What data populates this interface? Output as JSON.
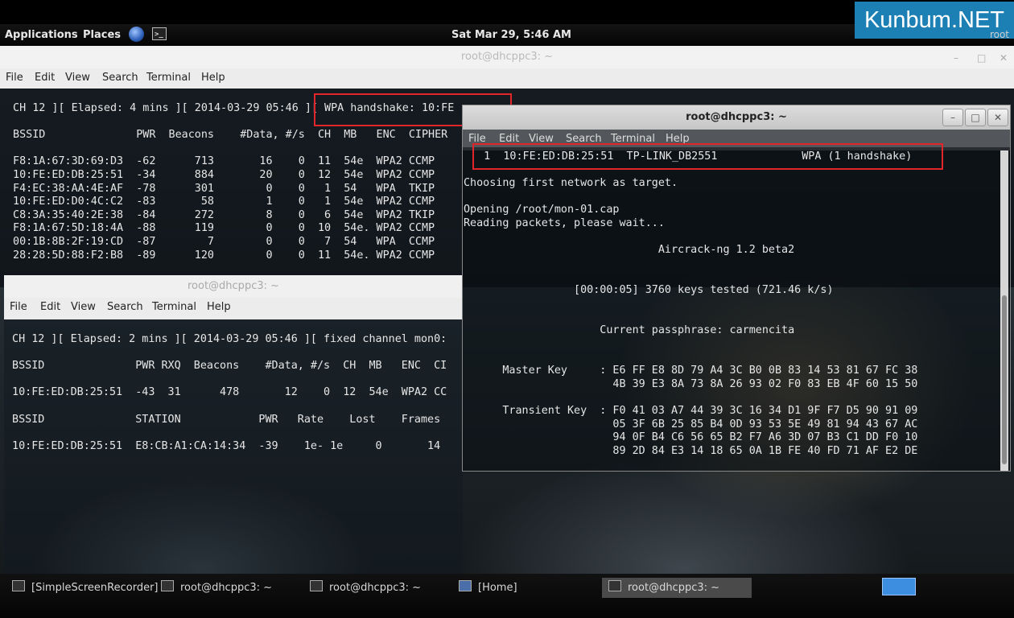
{
  "top_panel": {
    "applications": "Applications",
    "places": "Places",
    "clock": "Sat Mar 29,  5:46 AM",
    "user": "root",
    "watermark": "Kunbum.NET"
  },
  "window1": {
    "title": "root@dhcppc3: ~",
    "menu": [
      "File",
      "Edit",
      "View",
      "Search",
      "Terminal",
      "Help"
    ],
    "lines": [
      " CH 12 ][ Elapsed: 4 mins ][ 2014-03-29 05:46 ][ WPA handshake: 10:FE",
      "",
      " BSSID              PWR  Beacons    #Data, #/s  CH  MB   ENC  CIPHER",
      "",
      " F8:1A:67:3D:69:D3  -62      713       16    0  11  54e  WPA2 CCMP",
      " 10:FE:ED:DB:25:51  -34      884       20    0  12  54e  WPA2 CCMP",
      " F4:EC:38:AA:4E:AF  -78      301        0    0   1  54   WPA  TKIP",
      " 10:FE:ED:D0:4C:C2  -83       58        1    0   1  54e  WPA2 CCMP",
      " C8:3A:35:40:2E:38  -84      272        8    0   6  54e  WPA2 TKIP",
      " F8:1A:67:5D:18:4A  -88      119        0    0  10  54e. WPA2 CCMP",
      " 00:1B:8B:2F:19:CD  -87        7        0    0   7  54   WPA  CCMP",
      " 28:28:5D:88:F2:B8  -89      120        0    0  11  54e. WPA2 CCMP"
    ]
  },
  "window2": {
    "title": "root@dhcppc3: ~",
    "menu": [
      "File",
      "Edit",
      "View",
      "Search",
      "Terminal",
      "Help"
    ],
    "lines": [
      "",
      " CH 12 ][ Elapsed: 2 mins ][ 2014-03-29 05:46 ][ fixed channel mon0:",
      "",
      " BSSID              PWR RXQ  Beacons    #Data, #/s  CH  MB   ENC  CI",
      "",
      " 10:FE:ED:DB:25:51  -43  31      478       12    0  12  54e  WPA2 CC",
      "",
      " BSSID              STATION            PWR   Rate    Lost    Frames",
      "",
      " 10:FE:ED:DB:25:51  E8:CB:A1:CA:14:34  -39    1e- 1e     0       14"
    ]
  },
  "window3": {
    "title": "root@dhcppc3: ~",
    "menu": [
      "File",
      "Edit",
      "View",
      "Search",
      "Terminal",
      "Help"
    ],
    "lines": [
      "   1  10:FE:ED:DB:25:51  TP-LINK_DB2551             WPA (1 handshake)",
      "",
      "Choosing first network as target.",
      "",
      "Opening /root/mon-01.cap",
      "Reading packets, please wait...",
      "",
      "                              Aircrack-ng 1.2 beta2",
      "",
      "",
      "                 [00:00:05] 3760 keys tested (721.46 k/s)",
      "",
      "",
      "                     Current passphrase: carmencita",
      "",
      "",
      "      Master Key     : E6 FF E8 8D 79 A4 3C B0 0B 83 14 53 81 67 FC 38",
      "                       4B 39 E3 8A 73 8A 26 93 02 F0 83 EB 4F 60 15 50",
      "",
      "      Transient Key  : F0 41 03 A7 44 39 3C 16 34 D1 9F F7 D5 90 91 09",
      "                       05 3F 6B 25 85 B4 0D 93 53 5E 49 81 94 43 67 AC",
      "                       94 0F B4 C6 56 65 B2 F7 A6 3D 07 B3 C1 DD F0 10",
      "                       89 2D 84 E3 14 18 65 0A 1B FE 40 FD 71 AF E2 DE"
    ]
  },
  "taskbar": {
    "items": [
      "[SimpleScreenRecorder]",
      "root@dhcppc3: ~",
      "root@dhcppc3: ~",
      "[Home]",
      "root@dhcppc3: ~"
    ]
  }
}
